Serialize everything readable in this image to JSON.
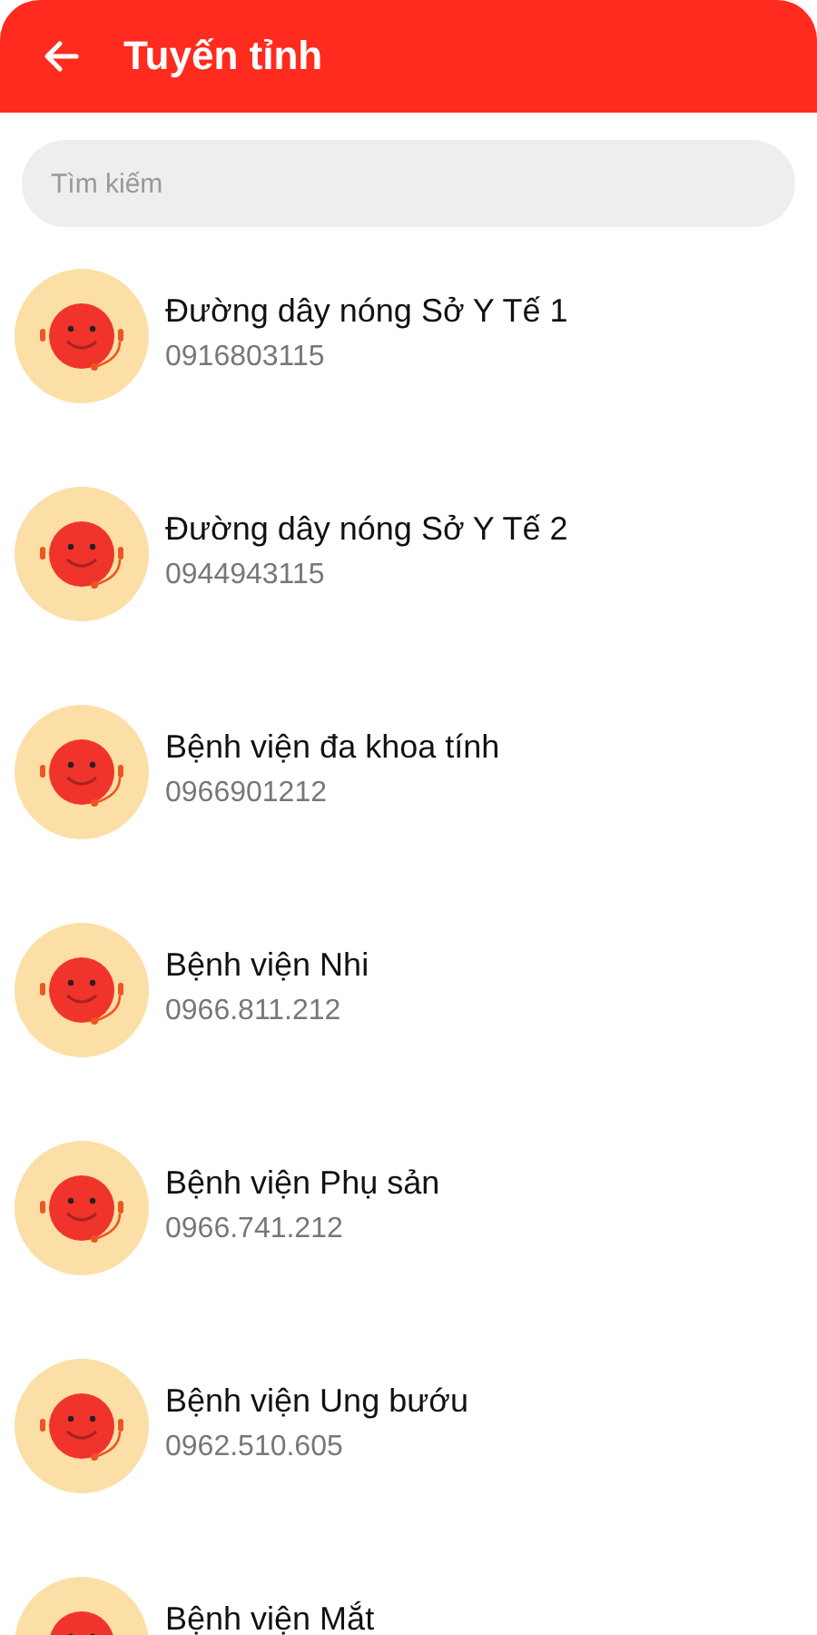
{
  "app_bar": {
    "title": "Tuyến tỉnh"
  },
  "search": {
    "placeholder": "Tìm kiếm"
  },
  "contacts": [
    {
      "name": "Đường dây nóng Sở Y Tế 1",
      "phone": "0916803115"
    },
    {
      "name": "Đường dây nóng Sở Y Tế 2",
      "phone": "0944943115"
    },
    {
      "name": "Bệnh viện đa khoa tính",
      "phone": "0966901212"
    },
    {
      "name": "Bệnh viện Nhi",
      "phone": "0966.811.212"
    },
    {
      "name": "Bệnh viện Phụ sản",
      "phone": "0966.741.212"
    },
    {
      "name": "Bệnh viện Ung bướu",
      "phone": "0962.510.605"
    },
    {
      "name": "Bệnh viện Mắt"
    }
  ]
}
